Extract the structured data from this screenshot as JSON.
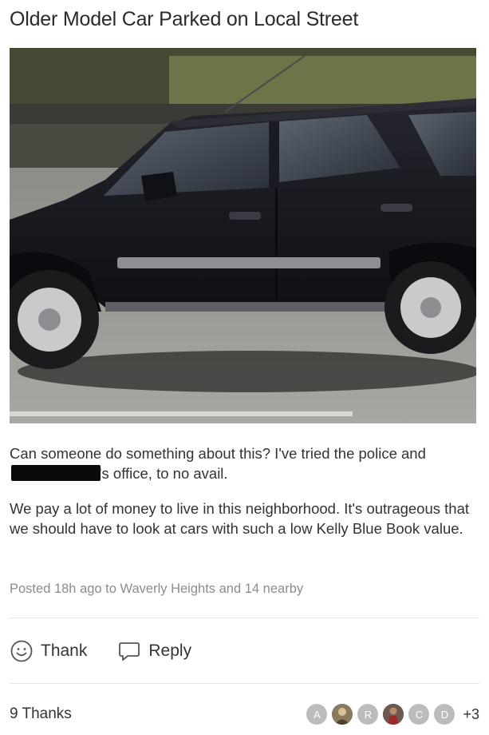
{
  "post": {
    "title": "Older Model Car Parked on Local Street",
    "paragraph1_before": "Can someone do something about this? I've tried the police and ",
    "paragraph1_after": "'s office, to no avail.",
    "paragraph2": "We pay a lot of money to live in this neighborhood. It's outrageous that we should have to look at cars with such a low Kelly Blue Book value.",
    "meta": "Posted 18h ago to Waverly Heights and 14 nearby"
  },
  "actions": {
    "thank_label": "Thank",
    "thank_icon": "smiley-icon",
    "reply_label": "Reply",
    "reply_icon": "speech-bubble-icon"
  },
  "footer": {
    "thanks_count": "9 Thanks",
    "avatars": [
      {
        "type": "initial",
        "label": "A",
        "color": "#c8c8c8"
      },
      {
        "type": "photo",
        "color": "#7a6a52"
      },
      {
        "type": "initial",
        "label": "R",
        "color": "#c8c8c8"
      },
      {
        "type": "photo",
        "color": "#5b4a44"
      },
      {
        "type": "initial",
        "label": "C",
        "color": "#c8c8c8"
      },
      {
        "type": "initial",
        "label": "D",
        "color": "#c8c8c8"
      }
    ],
    "more": "+3"
  },
  "colors": {
    "text": "#333333",
    "muted": "#8c8c8c",
    "car": "#15161d"
  }
}
